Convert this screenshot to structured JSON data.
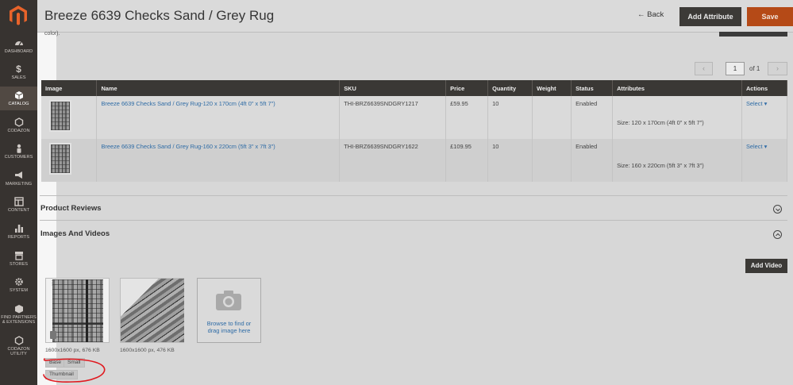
{
  "sidebar": {
    "items": [
      {
        "label": "Dashboard",
        "icon": "dashboard-icon"
      },
      {
        "label": "Sales",
        "icon": "dollar-icon"
      },
      {
        "label": "Catalog",
        "icon": "cube-icon",
        "active": true
      },
      {
        "label": "Codazon",
        "icon": "hexagon-icon"
      },
      {
        "label": "Customers",
        "icon": "person-icon"
      },
      {
        "label": "Marketing",
        "icon": "megaphone-icon"
      },
      {
        "label": "Content",
        "icon": "layout-icon"
      },
      {
        "label": "Reports",
        "icon": "bar-chart-icon"
      },
      {
        "label": "Stores",
        "icon": "store-icon"
      },
      {
        "label": "System",
        "icon": "gear-icon"
      },
      {
        "label": "Find Partners & Extensions",
        "icon": "puzzle-icon"
      },
      {
        "label": "Codazon Utility",
        "icon": "hexagon-icon"
      }
    ]
  },
  "header": {
    "title": "Breeze 6639 Checks Sand / Grey Rug",
    "back_label": "Back",
    "add_attribute_label": "Add Attribute",
    "save_label": "Save"
  },
  "color_note": "color).",
  "pager": {
    "prev": "‹",
    "current": "1",
    "of_label": "of 1",
    "next": "›"
  },
  "table": {
    "headers": [
      "Image",
      "Name",
      "SKU",
      "Price",
      "Quantity",
      "Weight",
      "Status",
      "Attributes",
      "Actions"
    ],
    "rows": [
      {
        "name": "Breeze 6639 Checks Sand / Grey Rug-120 x 170cm (4ft 0\" x 5ft 7\")",
        "sku": "THI-BRZ6639SNDGRY1217",
        "price": "£59.95",
        "quantity": "10",
        "weight": "",
        "status": "Enabled",
        "attributes": "Size: 120 x 170cm (4ft 0\" x 5ft 7\")",
        "action": "Select"
      },
      {
        "name": "Breeze 6639 Checks Sand / Grey Rug-160 x 220cm (5ft 3\" x 7ft 3\")",
        "sku": "THI-BRZ6639SNDGRY1622",
        "price": "£109.95",
        "quantity": "10",
        "weight": "",
        "status": "Enabled",
        "attributes": "Size: 160 x 220cm (5ft 3\" x 7ft 3\")",
        "action": "Select"
      }
    ]
  },
  "sections": {
    "reviews": "Product Reviews",
    "images": "Images And Videos",
    "add_video_label": "Add Video"
  },
  "images": [
    {
      "meta": "1600x1600 px, 676 KB"
    },
    {
      "meta": "1600x1600 px, 476 KB"
    }
  ],
  "uploader": {
    "browse_line1": "Browse to find or",
    "browse_line2": "drag image here"
  },
  "roles": {
    "base": "Base",
    "small": "Small",
    "thumbnail": "Thumbnail"
  },
  "colors": {
    "sidebar": "#373330",
    "save": "#b54a17",
    "annotation": "#e0191f",
    "link": "#2f6ca6"
  }
}
